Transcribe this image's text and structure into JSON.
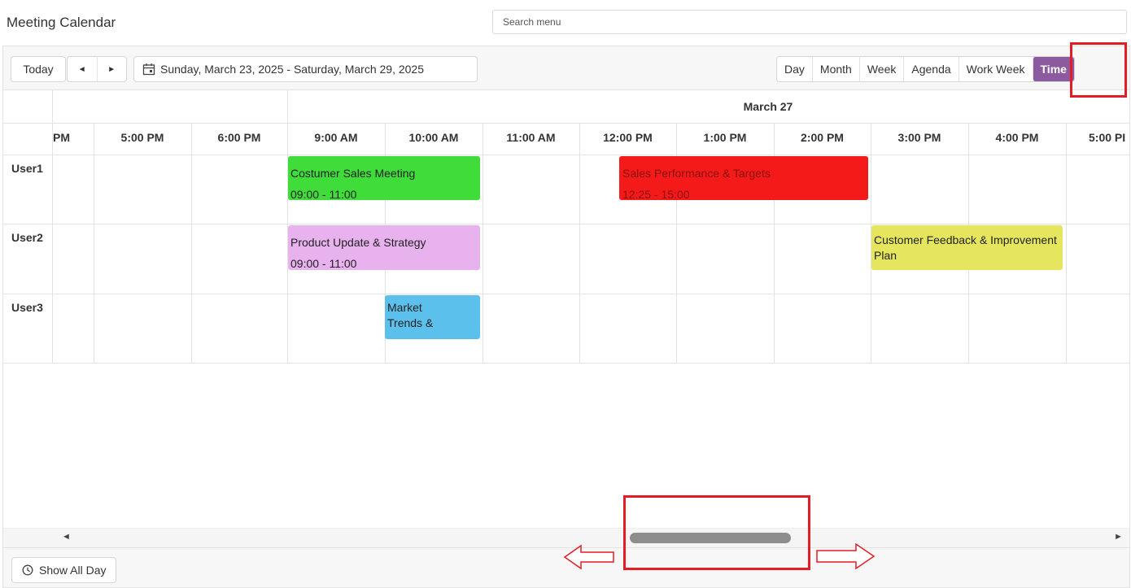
{
  "app": {
    "title": "Meeting Calendar"
  },
  "search": {
    "placeholder": "Search menu"
  },
  "toolbar": {
    "today_label": "Today",
    "prev_icon": "◄",
    "next_icon": "►",
    "date_range": "Sunday, March 23, 2025 - Saturday, March 29, 2025",
    "calendar_icon": "calendar-icon"
  },
  "views": [
    {
      "label": "Day",
      "active": false
    },
    {
      "label": "Month",
      "active": false
    },
    {
      "label": "Week",
      "active": false
    },
    {
      "label": "Agenda",
      "active": false
    },
    {
      "label": "Work Week",
      "active": false
    },
    {
      "label": "Time",
      "active": true
    }
  ],
  "timeline": {
    "date_header": "March 27",
    "time_slots": [
      "PM",
      "5:00 PM",
      "6:00 PM",
      "9:00 AM",
      "10:00 AM",
      "11:00 AM",
      "12:00 PM",
      "1:00 PM",
      "2:00 PM",
      "3:00 PM",
      "4:00 PM",
      "5:00 PI"
    ]
  },
  "resources": [
    "User1",
    "User2",
    "User3"
  ],
  "events": [
    {
      "resource": "User1",
      "title": "Costumer Sales Meeting",
      "time": "09:00 - 11:00",
      "color": "#3fdc3a"
    },
    {
      "resource": "User1",
      "title": "Sales Performance & Targets",
      "time": "12:25 - 15:00",
      "color": "#f51a1a"
    },
    {
      "resource": "User2",
      "title": "Product Update & Strategy",
      "time": "09:00 - 11:00",
      "color": "#e8b2ef"
    },
    {
      "resource": "User2",
      "title": "Customer Feedback & Improvement Plan",
      "time": "",
      "color": "#e6e65e"
    },
    {
      "resource": "User3",
      "title": "Market Trends &",
      "time": "",
      "color": "#5bc0eb"
    }
  ],
  "scrollbar": {
    "left_icon": "◄",
    "right_icon": "►"
  },
  "footer": {
    "show_all_day_label": "Show All Day",
    "clock_icon": "clock-icon"
  },
  "colors": {
    "accent": "#8c5a9e",
    "highlight": "#e31d26"
  }
}
